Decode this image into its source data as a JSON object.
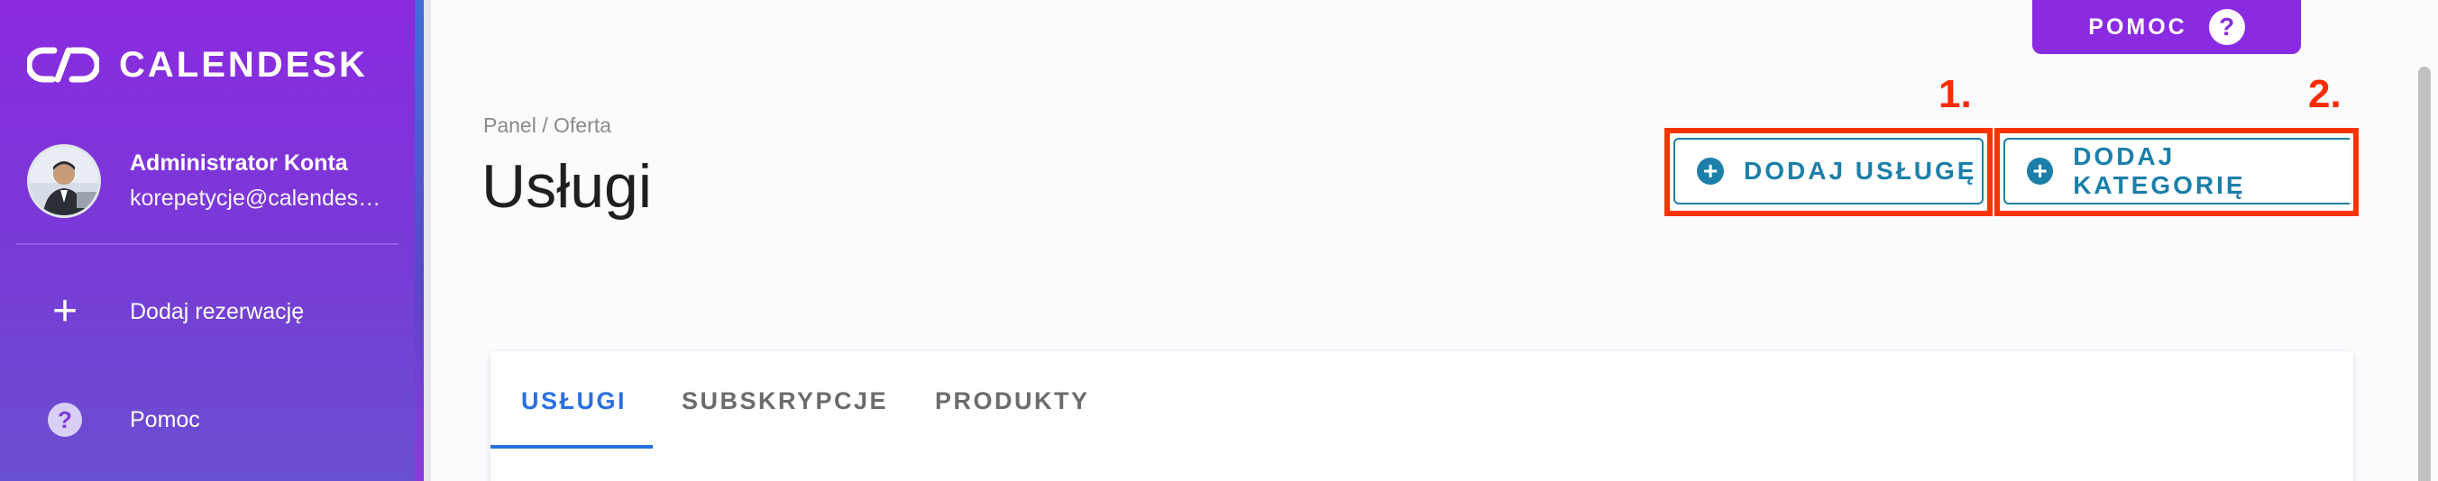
{
  "sidebar": {
    "brand": "CALENDESK",
    "user": {
      "name": "Administrator Konta",
      "email": "korepetycje@calendesk.com"
    },
    "items": [
      {
        "label": "Dodaj rezerwację",
        "icon": "plus-icon"
      },
      {
        "label": "Pomoc",
        "icon": "help-icon"
      }
    ]
  },
  "top_help": {
    "label": "POMOC",
    "icon_glyph": "?"
  },
  "header": {
    "breadcrumb": "Panel / Oferta",
    "title": "Usługi"
  },
  "actions": [
    {
      "label": "DODAJ USŁUGĘ",
      "marker": "1."
    },
    {
      "label": "DODAJ KATEGORIĘ",
      "marker": "2."
    }
  ],
  "tabs": [
    {
      "label": "USŁUGI",
      "active": true
    },
    {
      "label": "SUBSKRYPCJE",
      "active": false
    },
    {
      "label": "PRODUKTY",
      "active": false
    }
  ],
  "colors": {
    "sidebar_gradient_top": "#8b2ae0",
    "accent_purple": "#8a2be2",
    "action_teal": "#1b7fa9",
    "annotation_red": "#ff3300",
    "tab_active_blue": "#2a6fe0"
  }
}
